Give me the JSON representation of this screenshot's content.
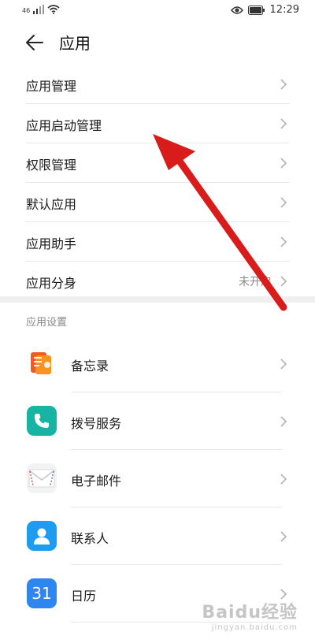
{
  "status_bar": {
    "signal_text": "46",
    "time": "12:29"
  },
  "header": {
    "title": "应用"
  },
  "menu": [
    {
      "label": "应用管理",
      "value": ""
    },
    {
      "label": "应用启动管理",
      "value": ""
    },
    {
      "label": "权限管理",
      "value": ""
    },
    {
      "label": "默认应用",
      "value": ""
    },
    {
      "label": "应用助手",
      "value": ""
    },
    {
      "label": "应用分身",
      "value": "未开启"
    }
  ],
  "section_title": "应用设置",
  "apps": [
    {
      "label": "备忘录",
      "icon": "notepad-icon"
    },
    {
      "label": "拨号服务",
      "icon": "phone-icon"
    },
    {
      "label": "电子邮件",
      "icon": "envelope-icon"
    },
    {
      "label": "联系人",
      "icon": "contact-icon"
    },
    {
      "label": "日历",
      "icon": "calendar-icon",
      "icon_text": "31"
    }
  ],
  "watermark": {
    "brand": "Baidu经验",
    "url": "jingyan.baidu.com"
  },
  "colors": {
    "annotation_arrow": "#e02020",
    "chevron": "#b3b3b3",
    "divider": "#efefef"
  }
}
